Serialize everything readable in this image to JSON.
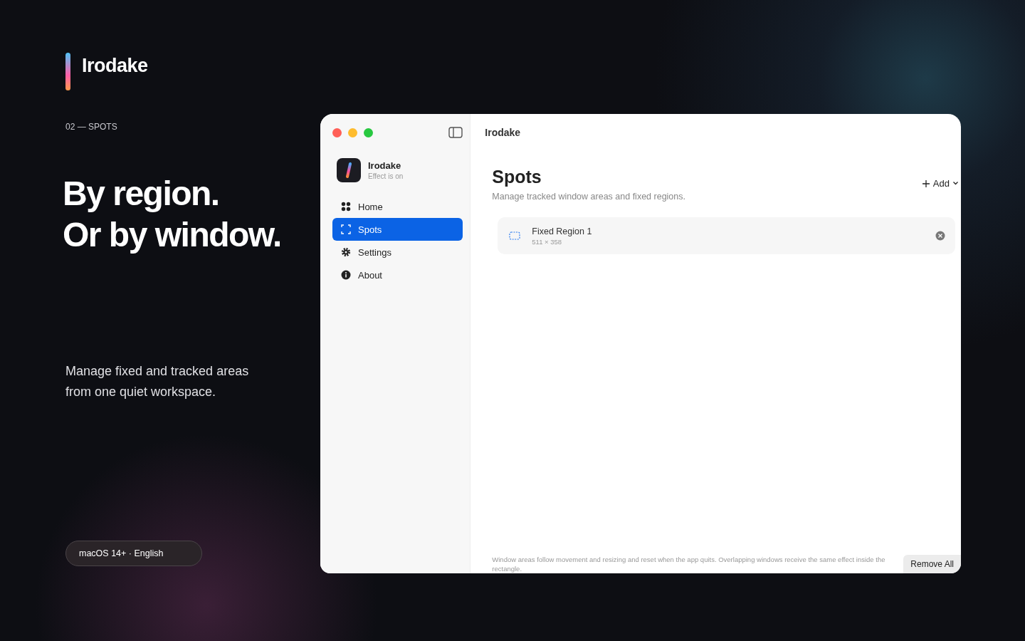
{
  "brand": {
    "name": "Irodake"
  },
  "eyebrow": "02 — SPOTS",
  "headline": [
    "By region.",
    "Or by window."
  ],
  "description": [
    "Manage fixed and tracked areas",
    "from one quiet workspace."
  ],
  "pill": "macOS 14+ · English",
  "window": {
    "title": "Irodake",
    "sidebar": {
      "app_name": "Irodake",
      "app_status": "Effect is on",
      "items": [
        {
          "label": "Home",
          "kind": "home",
          "selected": false
        },
        {
          "label": "Spots",
          "kind": "spots",
          "selected": true
        },
        {
          "label": "Settings",
          "kind": "settings",
          "selected": false
        },
        {
          "label": "About",
          "kind": "about",
          "selected": false
        }
      ]
    },
    "content": {
      "heading": "Spots",
      "subtitle": "Manage tracked window areas and fixed regions.",
      "add_button": "Add",
      "spots": [
        {
          "name": "Fixed Region 1",
          "size": "511 × 358"
        }
      ],
      "footnote": "Window areas follow movement and resizing and reset when the app quits. Overlapping windows receive the same effect inside the rectangle.",
      "remove_all": "Remove All"
    }
  }
}
